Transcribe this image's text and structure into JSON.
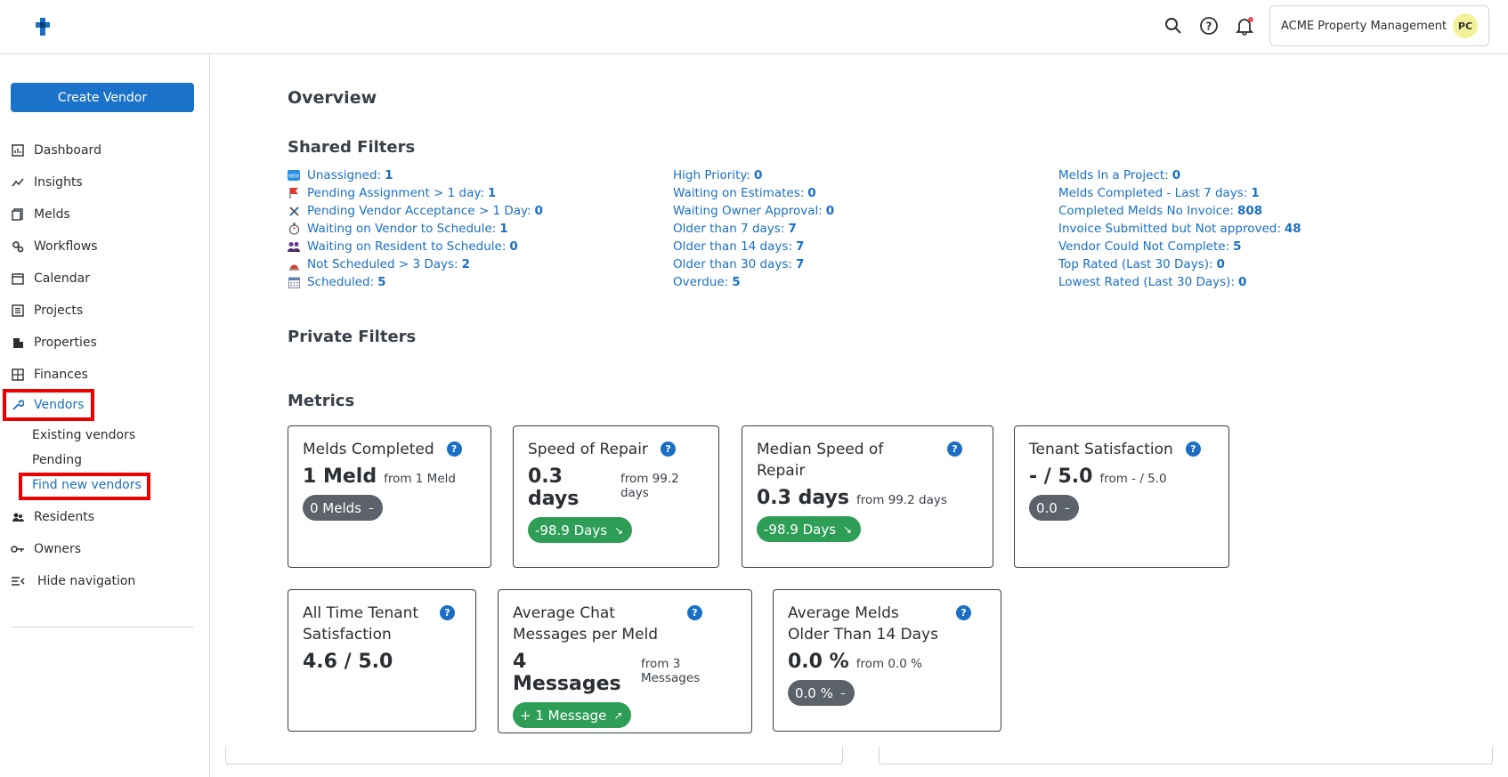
{
  "header": {
    "account_name": "ACME Property Management",
    "avatar_initials": "PC"
  },
  "sidebar": {
    "create_button": "Create Vendor",
    "items": [
      {
        "label": "Dashboard",
        "icon": "dashboard-icon"
      },
      {
        "label": "Insights",
        "icon": "insights-icon"
      },
      {
        "label": "Melds",
        "icon": "melds-icon"
      },
      {
        "label": "Workflows",
        "icon": "workflows-icon"
      },
      {
        "label": "Calendar",
        "icon": "calendar-icon"
      },
      {
        "label": "Projects",
        "icon": "projects-icon"
      },
      {
        "label": "Properties",
        "icon": "properties-icon"
      },
      {
        "label": "Finances",
        "icon": "finances-icon"
      },
      {
        "label": "Vendors",
        "icon": "wrench-icon"
      },
      {
        "label": "Residents",
        "icon": "residents-icon"
      },
      {
        "label": "Owners",
        "icon": "key-icon"
      },
      {
        "label": "Hide navigation",
        "icon": "hide-navigation-icon"
      }
    ],
    "vendor_sub": [
      "Existing vendors",
      "Pending",
      "Find new vendors"
    ]
  },
  "main": {
    "title": "Overview",
    "shared_filters_title": "Shared Filters",
    "private_filters_title": "Private Filters",
    "metrics_title": "Metrics",
    "filters_col1": [
      {
        "label": "Unassigned:",
        "count": "1",
        "icon": "new-icon"
      },
      {
        "label": "Pending Assignment > 1 day:",
        "count": "1",
        "icon": "flag-icon"
      },
      {
        "label": "Pending Vendor Acceptance > 1 Day:",
        "count": "0",
        "icon": "tools-icon"
      },
      {
        "label": "Waiting on Vendor to Schedule:",
        "count": "1",
        "icon": "stopwatch-icon"
      },
      {
        "label": "Waiting on Resident to Schedule:",
        "count": "0",
        "icon": "people-icon"
      },
      {
        "label": "Not Scheduled > 3 Days:",
        "count": "2",
        "icon": "alarm-icon"
      },
      {
        "label": "Scheduled:",
        "count": "5",
        "icon": "calendar-icon"
      }
    ],
    "filters_col2": [
      {
        "label": "High Priority:",
        "count": "0"
      },
      {
        "label": "Waiting on Estimates:",
        "count": "0"
      },
      {
        "label": "Waiting Owner Approval:",
        "count": "0"
      },
      {
        "label": "Older than 7 days:",
        "count": "7"
      },
      {
        "label": "Older than 14 days:",
        "count": "7"
      },
      {
        "label": "Older than 30 days:",
        "count": "7"
      },
      {
        "label": "Overdue:",
        "count": "5"
      }
    ],
    "filters_col3": [
      {
        "label": "Melds In a Project:",
        "count": "0"
      },
      {
        "label": "Melds Completed - Last 7 days:",
        "count": "1"
      },
      {
        "label": "Completed Melds No Invoice:",
        "count": "808"
      },
      {
        "label": "Invoice Submitted but Not approved:",
        "count": "48"
      },
      {
        "label": "Vendor Could Not Complete:",
        "count": "5"
      },
      {
        "label": "Top Rated (Last 30 Days):",
        "count": "0"
      },
      {
        "label": "Lowest Rated (Last 30 Days):",
        "count": "0"
      }
    ],
    "metrics": [
      {
        "title": "Melds Completed",
        "value": "1 Meld",
        "from": "from 1 Meld",
        "pill": "0 Melds",
        "pill_icon": "–",
        "pill_color": "grey"
      },
      {
        "title": "Speed of Repair",
        "value": "0.3 days",
        "from": "from 99.2 days",
        "pill": "-98.9 Days",
        "pill_icon": "↘",
        "pill_color": "green"
      },
      {
        "title": "Median Speed of Repair",
        "value": "0.3 days",
        "from": "from 99.2 days",
        "pill": "-98.9 Days",
        "pill_icon": "↘",
        "pill_color": "green"
      },
      {
        "title": "Tenant Satisfaction",
        "value": "- / 5.0",
        "from": "from - / 5.0",
        "pill": "0.0",
        "pill_icon": "–",
        "pill_color": "grey"
      },
      {
        "title": "All Time Tenant Satisfaction",
        "value": "4.6 / 5.0",
        "from": "",
        "pill": "",
        "pill_icon": "",
        "pill_color": ""
      },
      {
        "title": "Average Chat Messages per Meld",
        "value": "4 Messages",
        "from": "from 3 Messages",
        "pill": "+ 1 Message",
        "pill_icon": "↗",
        "pill_color": "green"
      },
      {
        "title": "Average Melds Older Than 14 Days",
        "value": "0.0 %",
        "from": "from 0.0 %",
        "pill": "0.0 %",
        "pill_icon": "–",
        "pill_color": "grey"
      }
    ]
  },
  "colors": {
    "accent": "#1a73c8",
    "link": "#1a6fc4",
    "green": "#2e9e57",
    "grey_pill": "#5b6269",
    "highlight": "#ee0000"
  }
}
